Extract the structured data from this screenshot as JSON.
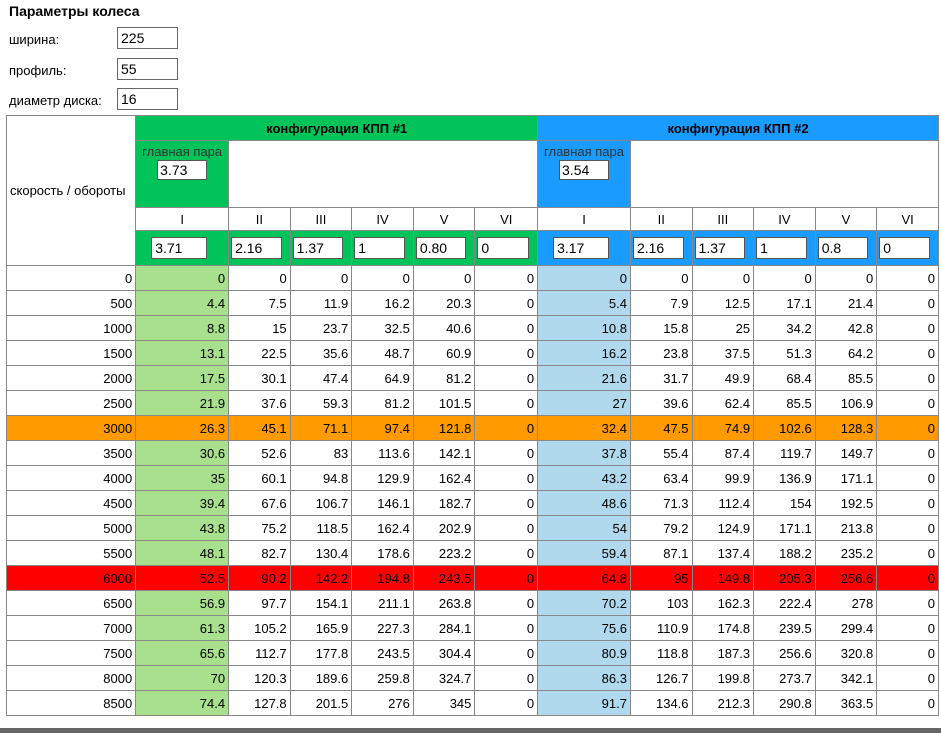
{
  "wheel": {
    "title": "Параметры колеса",
    "width_label": "ширина:",
    "width_value": "225",
    "profile_label": "профиль:",
    "profile_value": "55",
    "diameter_label": "диаметр диска:",
    "diameter_value": "16"
  },
  "table": {
    "rpm_header": "скорость / обороты",
    "main_pair_label": "главная пара",
    "cfg1": {
      "title": "конфигурация КПП #1",
      "main_pair": "3.73",
      "ratios": [
        "3.71",
        "2.16",
        "1.37",
        "1",
        "0.80",
        "0"
      ]
    },
    "cfg2": {
      "title": "конфигурация КПП #2",
      "main_pair": "3.54",
      "ratios": [
        "3.17",
        "2.16",
        "1.37",
        "1",
        "0.8",
        "0"
      ]
    },
    "gears": [
      "I",
      "II",
      "III",
      "IV",
      "V",
      "VI"
    ],
    "rows": [
      {
        "rpm": "0",
        "c1": [
          "0",
          "0",
          "0",
          "0",
          "0",
          "0"
        ],
        "c2": [
          "0",
          "0",
          "0",
          "0",
          "0",
          "0"
        ]
      },
      {
        "rpm": "500",
        "c1": [
          "4.4",
          "7.5",
          "11.9",
          "16.2",
          "20.3",
          "0"
        ],
        "c2": [
          "5.4",
          "7.9",
          "12.5",
          "17.1",
          "21.4",
          "0"
        ]
      },
      {
        "rpm": "1000",
        "c1": [
          "8.8",
          "15",
          "23.7",
          "32.5",
          "40.6",
          "0"
        ],
        "c2": [
          "10.8",
          "15.8",
          "25",
          "34.2",
          "42.8",
          "0"
        ]
      },
      {
        "rpm": "1500",
        "c1": [
          "13.1",
          "22.5",
          "35.6",
          "48.7",
          "60.9",
          "0"
        ],
        "c2": [
          "16.2",
          "23.8",
          "37.5",
          "51.3",
          "64.2",
          "0"
        ]
      },
      {
        "rpm": "2000",
        "c1": [
          "17.5",
          "30.1",
          "47.4",
          "64.9",
          "81.2",
          "0"
        ],
        "c2": [
          "21.6",
          "31.7",
          "49.9",
          "68.4",
          "85.5",
          "0"
        ]
      },
      {
        "rpm": "2500",
        "c1": [
          "21.9",
          "37.6",
          "59.3",
          "81.2",
          "101.5",
          "0"
        ],
        "c2": [
          "27",
          "39.6",
          "62.4",
          "85.5",
          "106.9",
          "0"
        ]
      },
      {
        "rpm": "3000",
        "c1": [
          "26.3",
          "45.1",
          "71.1",
          "97.4",
          "121.8",
          "0"
        ],
        "c2": [
          "32.4",
          "47.5",
          "74.9",
          "102.6",
          "128.3",
          "0"
        ],
        "hl": "orange"
      },
      {
        "rpm": "3500",
        "c1": [
          "30.6",
          "52.6",
          "83",
          "113.6",
          "142.1",
          "0"
        ],
        "c2": [
          "37.8",
          "55.4",
          "87.4",
          "119.7",
          "149.7",
          "0"
        ]
      },
      {
        "rpm": "4000",
        "c1": [
          "35",
          "60.1",
          "94.8",
          "129.9",
          "162.4",
          "0"
        ],
        "c2": [
          "43.2",
          "63.4",
          "99.9",
          "136.9",
          "171.1",
          "0"
        ]
      },
      {
        "rpm": "4500",
        "c1": [
          "39.4",
          "67.6",
          "106.7",
          "146.1",
          "182.7",
          "0"
        ],
        "c2": [
          "48.6",
          "71.3",
          "112.4",
          "154",
          "192.5",
          "0"
        ]
      },
      {
        "rpm": "5000",
        "c1": [
          "43.8",
          "75.2",
          "118.5",
          "162.4",
          "202.9",
          "0"
        ],
        "c2": [
          "54",
          "79.2",
          "124.9",
          "171.1",
          "213.8",
          "0"
        ]
      },
      {
        "rpm": "5500",
        "c1": [
          "48.1",
          "82.7",
          "130.4",
          "178.6",
          "223.2",
          "0"
        ],
        "c2": [
          "59.4",
          "87.1",
          "137.4",
          "188.2",
          "235.2",
          "0"
        ]
      },
      {
        "rpm": "6000",
        "c1": [
          "52.5",
          "90.2",
          "142.2",
          "194.8",
          "243.5",
          "0"
        ],
        "c2": [
          "64.8",
          "95",
          "149.8",
          "205.3",
          "256.6",
          "0"
        ],
        "hl": "red"
      },
      {
        "rpm": "6500",
        "c1": [
          "56.9",
          "97.7",
          "154.1",
          "211.1",
          "263.8",
          "0"
        ],
        "c2": [
          "70.2",
          "103",
          "162.3",
          "222.4",
          "278",
          "0"
        ]
      },
      {
        "rpm": "7000",
        "c1": [
          "61.3",
          "105.2",
          "165.9",
          "227.3",
          "284.1",
          "0"
        ],
        "c2": [
          "75.6",
          "110.9",
          "174.8",
          "239.5",
          "299.4",
          "0"
        ]
      },
      {
        "rpm": "7500",
        "c1": [
          "65.6",
          "112.7",
          "177.8",
          "243.5",
          "304.4",
          "0"
        ],
        "c2": [
          "80.9",
          "118.8",
          "187.3",
          "256.6",
          "320.8",
          "0"
        ]
      },
      {
        "rpm": "8000",
        "c1": [
          "70",
          "120.3",
          "189.6",
          "259.8",
          "324.7",
          "0"
        ],
        "c2": [
          "86.3",
          "126.7",
          "199.8",
          "273.7",
          "342.1",
          "0"
        ]
      },
      {
        "rpm": "8500",
        "c1": [
          "74.4",
          "127.8",
          "201.5",
          "276",
          "345",
          "0"
        ],
        "c2": [
          "91.7",
          "134.6",
          "212.3",
          "290.8",
          "363.5",
          "0"
        ]
      }
    ]
  }
}
